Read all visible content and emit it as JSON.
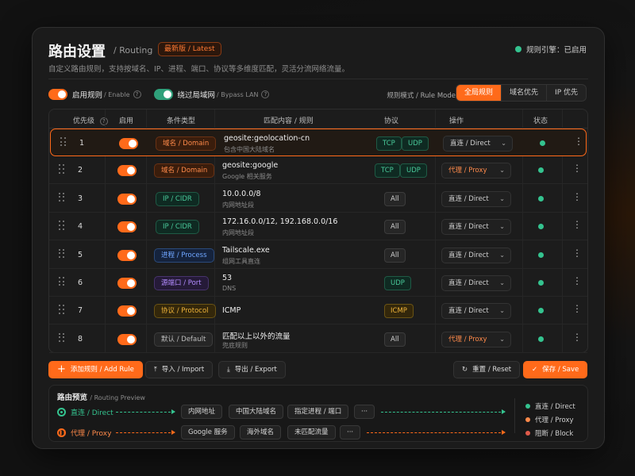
{
  "header": {
    "title": "路由设置",
    "subtitle": "/ Routing",
    "badge": "最新版 / Latest",
    "engine_status": "规则引擎：已启用",
    "description": "自定义路由规则，支持按域名、IP、进程、端口、协议等多维度匹配，灵活分流网络流量。"
  },
  "toolbar": {
    "enable_rules_label": "启用规则",
    "enable_rules_sub": "/ Enable",
    "bypass_lan_label": "绕过局域网",
    "bypass_lan_sub": "/ Bypass LAN",
    "mode_label": "规则模式 / Rule Mode",
    "modes": [
      "全局规则",
      "域名优先",
      "IP 优先"
    ]
  },
  "columns": {
    "priority": "优先级",
    "enable": "启用",
    "type": "条件类型",
    "match": "匹配内容 / 规则",
    "protocol": "协议",
    "action": "操作",
    "status": "状态"
  },
  "rows": [
    {
      "priority": "1",
      "type": "域名 / Domain",
      "match": "geosite:geolocation-cn",
      "note": "包含中国大陆域名",
      "protocols": [
        "TCP",
        "UDP"
      ],
      "action": "直连 / Direct"
    },
    {
      "priority": "2",
      "type": "域名 / Domain",
      "match": "geosite:google",
      "note": "Google 相关服务",
      "protocols": [
        "TCP",
        "UDP"
      ],
      "action": "代理 / Proxy"
    },
    {
      "priority": "3",
      "type": "IP / CIDR",
      "match": "10.0.0.0/8",
      "note": "内网地址段",
      "protocols": [
        "All"
      ],
      "action": "直连 / Direct"
    },
    {
      "priority": "4",
      "type": "IP / CIDR",
      "match": "172.16.0.0/12, 192.168.0.0/16",
      "note": "内网地址段",
      "protocols": [
        "All"
      ],
      "action": "直连 / Direct"
    },
    {
      "priority": "5",
      "type": "进程 / Process",
      "match": "Tailscale.exe",
      "note": "组网工具直连",
      "protocols": [
        "All"
      ],
      "action": "直连 / Direct"
    },
    {
      "priority": "6",
      "type": "源端口 / Port",
      "match": "53",
      "note": "DNS",
      "protocols": [
        "UDP"
      ],
      "action": "直连 / Direct"
    },
    {
      "priority": "7",
      "type": "协议 / Protocol",
      "match": "ICMP",
      "note": "",
      "protocols": [
        "ICMP"
      ],
      "action": "直连 / Direct"
    },
    {
      "priority": "8",
      "type": "默认 / Default",
      "match": "匹配以上以外的流量",
      "note": "兜底规则",
      "protocols": [
        "All"
      ],
      "action": "代理 / Proxy"
    }
  ],
  "buttons": {
    "add": "添加规则 / Add Rule",
    "import": "导入 / Import",
    "export": "导出 / Export",
    "reset": "重置 / Reset",
    "save": "保存 / Save"
  },
  "preview": {
    "title": "路由预览",
    "title_sub": "/ Routing Preview",
    "direct_label": "直连 / Direct",
    "proxy_label": "代理 / Proxy",
    "direct_chips": [
      "内网地址",
      "中国大陆域名",
      "指定进程 / 端口",
      "···"
    ],
    "proxy_chips": [
      "Google 服务",
      "海外域名",
      "未匹配流量",
      "···"
    ],
    "legend": [
      "直连 / Direct",
      "代理 / Proxy",
      "阻断 / Block"
    ]
  },
  "colors": {
    "accent": "#ff6a1a",
    "direct": "#34c38f",
    "proxy": "#ff8a4a",
    "block": "#e05a4a"
  }
}
